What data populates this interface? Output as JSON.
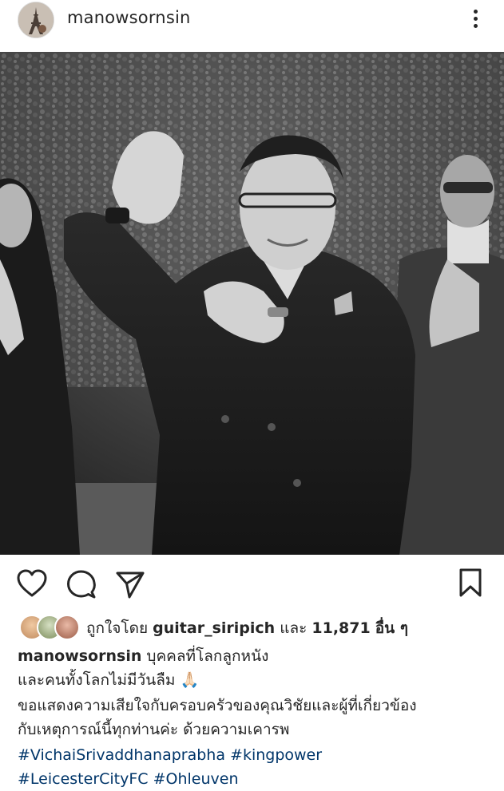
{
  "post": {
    "username": "manowsornsin",
    "likes_prefix": "ถูกใจโดย",
    "liked_by": "guitar_siripich",
    "likes_and": "และ",
    "likes_count": "11,871",
    "likes_suffix": "อื่น ๆ"
  },
  "caption": {
    "username": "manowsornsin",
    "line1": "บุคคลที่โลกลูกหนัง",
    "line2": "และคนทั้งโลกไม่มีวันลืม",
    "line2_emoji": "🙏🏻",
    "line3": "ขอแสดงความเสียใจกับครอบครัวของคุณวิชัยและผู้ที่เกี่ยวข้อง",
    "line4": "กับเหตุการณ์นี้ทุกท่านค่ะ ด้วยความเคารพ",
    "hashtags": [
      "#VichaiSrivaddhanaprabha",
      "#kingpower",
      "#LeicesterCityFC",
      "#Ohleuven"
    ]
  },
  "icons": {
    "avatar": "profile-avatar",
    "more": "more-options-icon",
    "like": "heart-icon",
    "comment": "comment-icon",
    "share": "send-icon",
    "save": "bookmark-icon"
  }
}
